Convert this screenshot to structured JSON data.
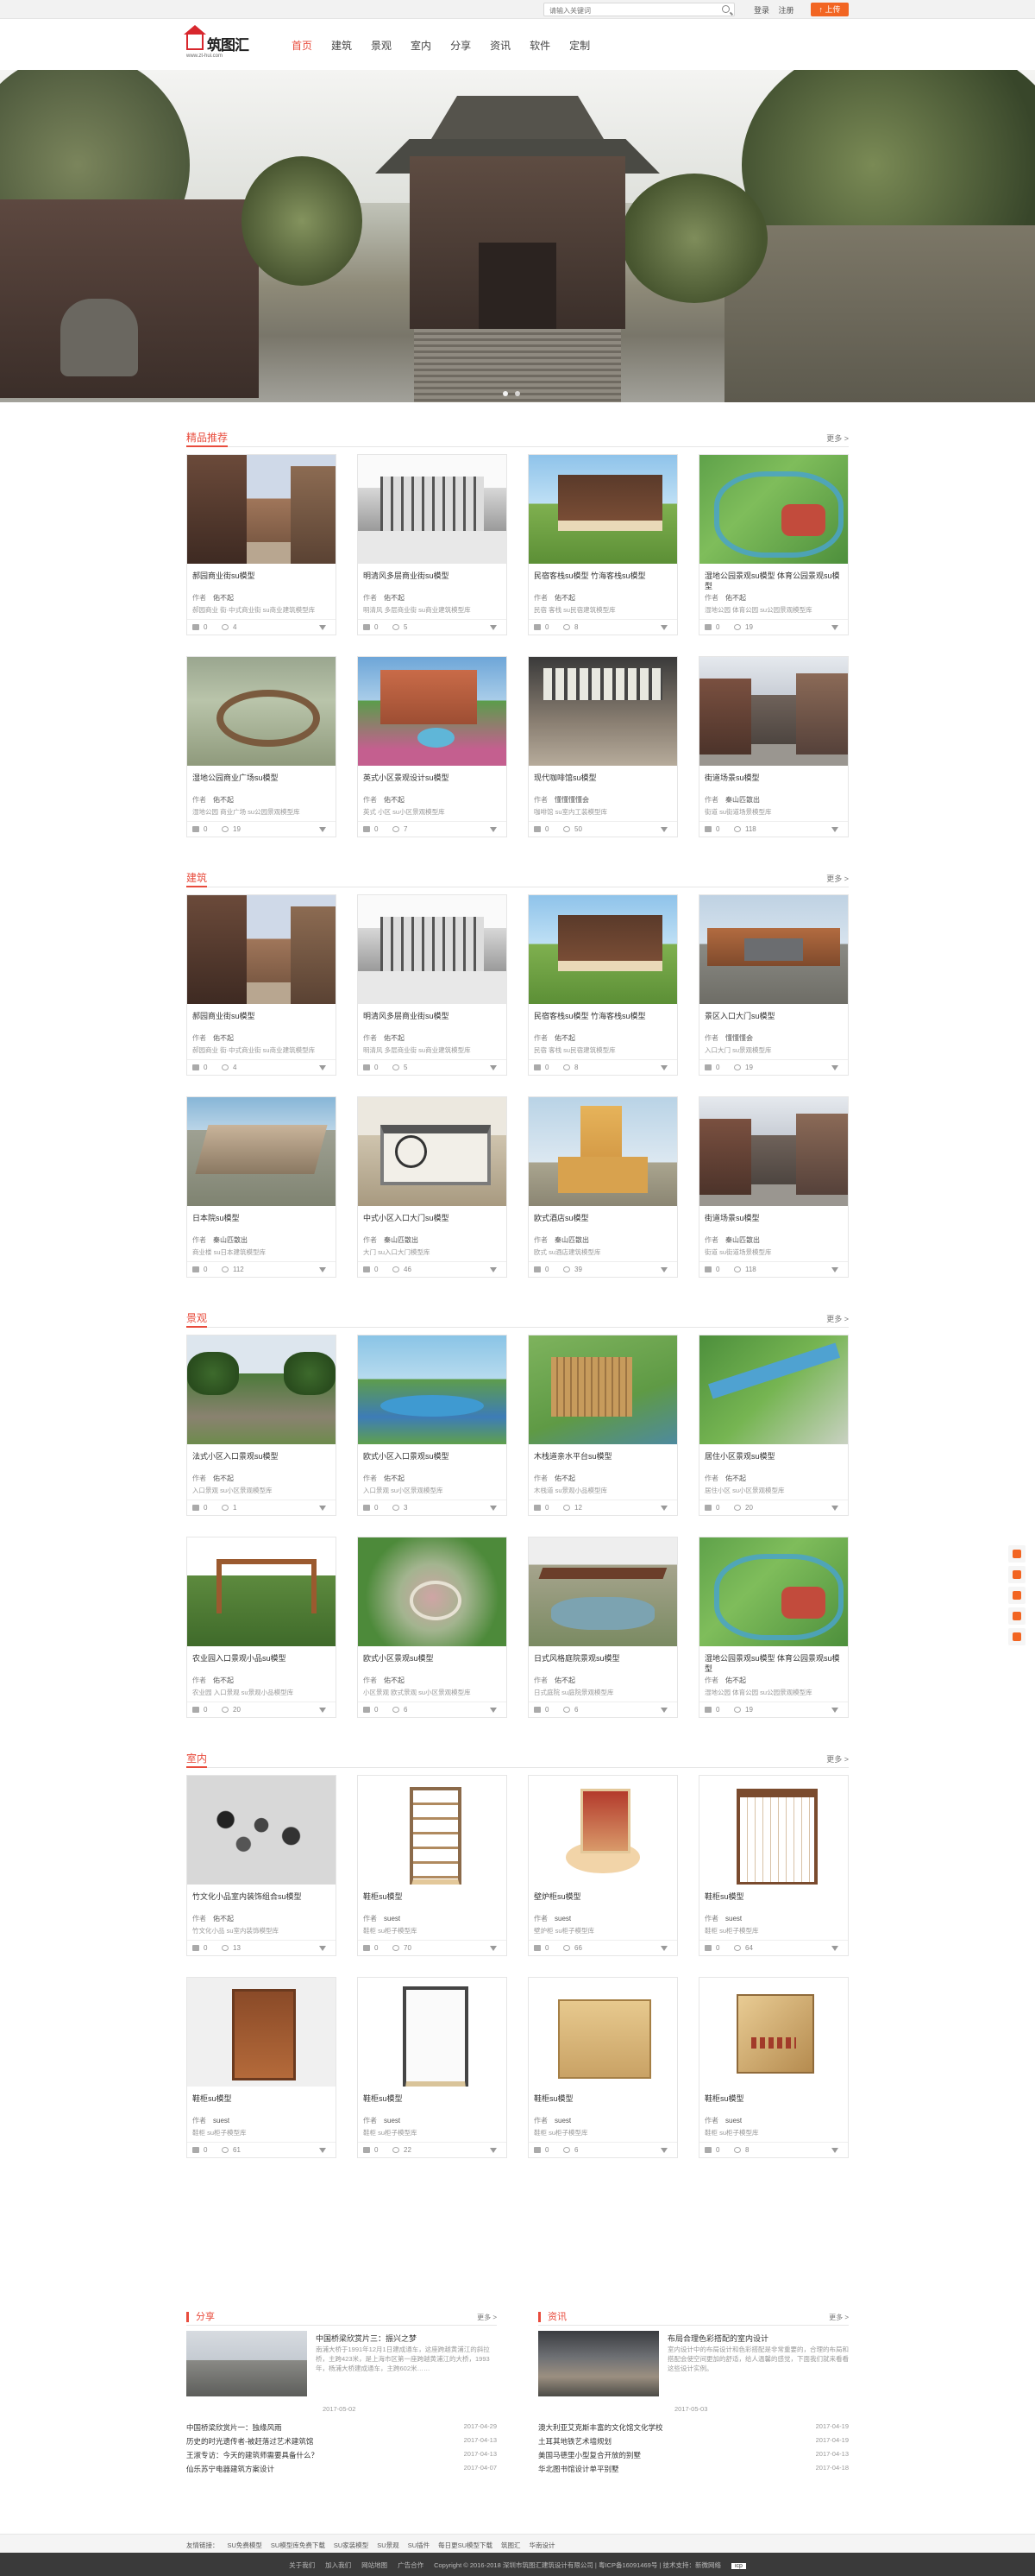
{
  "topbar": {
    "search_placeholder": "请输入关键词",
    "login": "登录",
    "register": "注册",
    "upload": "上传"
  },
  "logo": {
    "name": "筑图汇",
    "url": "www.zt-hui.com"
  },
  "nav": [
    "首页",
    "建筑",
    "景观",
    "室内",
    "分享",
    "资讯",
    "软件",
    "定制"
  ],
  "sections": [
    {
      "title": "精品推荐",
      "more": "更多 >",
      "cards": [
        {
          "title": "郝园商业街su模型",
          "author": "作者",
          "author_name": "佑不起",
          "tags": "郝园商业 街·中式商业街 su商业建筑模型库",
          "likes": "0",
          "views": "4",
          "scene": "s-street"
        },
        {
          "title": "明清风多层商业街su模型",
          "author": "作者",
          "author_name": "佑不起",
          "tags": "明清风 多层商业街 su商业建筑模型库",
          "likes": "0",
          "views": "5",
          "scene": "s-sketch"
        },
        {
          "title": "民宿客栈su模型 竹海客栈su模型",
          "author": "作者",
          "author_name": "佑不起",
          "tags": "民宿 客栈 su民宿建筑模型库",
          "likes": "0",
          "views": "8",
          "scene": "s-house"
        },
        {
          "title": "湿地公园景观su模型 体育公园景观su模型",
          "author": "作者",
          "author_name": "佑不起",
          "tags": "湿地公园 体育公园 su公园景观模型库",
          "likes": "0",
          "views": "19",
          "scene": "s-park"
        },
        {
          "title": "湿地公园商业广场su模型",
          "author": "作者",
          "author_name": "佑不起",
          "tags": "湿地公园 商业广场 su公园景观模型库",
          "likes": "0",
          "views": "19",
          "scene": "s-square"
        },
        {
          "title": "英式小区景观设计su模型",
          "author": "作者",
          "author_name": "佑不起",
          "tags": "英式 小区 su小区景观模型库",
          "likes": "0",
          "views": "7",
          "scene": "s-villa"
        },
        {
          "title": "现代咖啡馆su模型",
          "author": "作者",
          "author_name": "懂懂懂懂会",
          "tags": "咖啡馆 su室内工装模型库",
          "likes": "0",
          "views": "50",
          "scene": "s-cafe"
        },
        {
          "title": "街道场景su模型",
          "author": "作者",
          "author_name": "秦山匹散出",
          "tags": "街道 su街道场景模型库",
          "likes": "0",
          "views": "118",
          "scene": "s-road"
        }
      ]
    },
    {
      "title": "建筑",
      "more": "更多 >",
      "cards": [
        {
          "title": "郝园商业街su模型",
          "author": "作者",
          "author_name": "佑不起",
          "tags": "郝园商业 街·中式商业街 su商业建筑模型库",
          "likes": "0",
          "views": "4",
          "scene": "s-street"
        },
        {
          "title": "明清风多层商业街su模型",
          "author": "作者",
          "author_name": "佑不起",
          "tags": "明清风 多层商业街 su商业建筑模型库",
          "likes": "0",
          "views": "5",
          "scene": "s-sketch"
        },
        {
          "title": "民宿客栈su模型 竹海客栈su模型",
          "author": "作者",
          "author_name": "佑不起",
          "tags": "民宿 客栈 su民宿建筑模型库",
          "likes": "0",
          "views": "8",
          "scene": "s-house"
        },
        {
          "title": "景区入口大门su模型",
          "author": "作者",
          "author_name": "懂懂懂会",
          "tags": "入口大门 su景观模型库",
          "likes": "0",
          "views": "19",
          "scene": "s-gate"
        },
        {
          "title": "日本院su模型",
          "author": "作者",
          "author_name": "秦山匹散出",
          "tags": "商业楼 su日本建筑模型库",
          "likes": "0",
          "views": "112",
          "scene": "s-plaza"
        },
        {
          "title": "中式小区入口大门su模型",
          "author": "作者",
          "author_name": "秦山匹散出",
          "tags": "大门 su入口大门模型库",
          "likes": "0",
          "views": "46",
          "scene": "s-entry"
        },
        {
          "title": "欧式酒店su模型",
          "author": "作者",
          "author_name": "秦山匹散出",
          "tags": "欧式 su酒店建筑模型库",
          "likes": "0",
          "views": "39",
          "scene": "s-tower"
        },
        {
          "title": "街道场景su模型",
          "author": "作者",
          "author_name": "秦山匹散出",
          "tags": "街道 su街道场景模型库",
          "likes": "0",
          "views": "118",
          "scene": "s-road"
        }
      ]
    },
    {
      "title": "景观",
      "more": "更多 >",
      "cards": [
        {
          "title": "法式小区入口景观su模型",
          "author": "作者",
          "author_name": "佑不起",
          "tags": "入口景观 su小区景观模型库",
          "likes": "0",
          "views": "1",
          "scene": "s-avenue"
        },
        {
          "title": "欧式小区入口景观su模型",
          "author": "作者",
          "author_name": "佑不起",
          "tags": "入口景观 su小区景观模型库",
          "likes": "0",
          "views": "3",
          "scene": "s-pond"
        },
        {
          "title": "木栈道亲水平台su模型",
          "author": "作者",
          "author_name": "佑不起",
          "tags": "木栈道 su景观小品模型库",
          "likes": "0",
          "views": "12",
          "scene": "s-deck"
        },
        {
          "title": "居住小区景观su模型",
          "author": "作者",
          "author_name": "佑不起",
          "tags": "居住小区 su小区景观模型库",
          "likes": "0",
          "views": "20",
          "scene": "s-green"
        },
        {
          "title": "农业园入口景观小品su模型",
          "author": "作者",
          "author_name": "佑不起",
          "tags": "农业园 入口景观 su景观小品模型库",
          "likes": "0",
          "views": "20",
          "scene": "s-arch"
        },
        {
          "title": "欧式小区景观su模型",
          "author": "作者",
          "author_name": "佑不起",
          "tags": "小区景观 欧式景观 su小区景观模型库",
          "likes": "0",
          "views": "6",
          "scene": "s-garden"
        },
        {
          "title": "日式风格庭院景观su模型",
          "author": "作者",
          "author_name": "佑不起",
          "tags": "日式庭院 su庭院景观模型库",
          "likes": "0",
          "views": "6",
          "scene": "s-pavilion"
        },
        {
          "title": "湿地公园景观su模型 体育公园景观su模型",
          "author": "作者",
          "author_name": "佑不起",
          "tags": "湿地公园 体育公园 su公园景观模型库",
          "likes": "0",
          "views": "19",
          "scene": "s-park"
        }
      ]
    },
    {
      "title": "室内",
      "more": "更多 >",
      "cards": [
        {
          "title": "竹文化小品室内装饰组合su模型",
          "author": "作者",
          "author_name": "佑不起",
          "tags": "竹文化小品 su室内装饰模型库",
          "likes": "0",
          "views": "13",
          "scene": "s-parts"
        },
        {
          "title": "鞋柜su模型",
          "author": "作者",
          "author_name": "suest",
          "tags": "鞋柜 su柜子模型库",
          "likes": "0",
          "views": "70",
          "scene": "s-shelf"
        },
        {
          "title": "壁炉柜su模型",
          "author": "作者",
          "author_name": "suest",
          "tags": "壁炉柜 su柜子模型库",
          "likes": "0",
          "views": "66",
          "scene": "s-fire"
        },
        {
          "title": "鞋柜su模型",
          "author": "作者",
          "author_name": "suest",
          "tags": "鞋柜 su柜子模型库",
          "likes": "0",
          "views": "64",
          "scene": "s-rack"
        },
        {
          "title": "鞋柜su模型",
          "author": "作者",
          "author_name": "suest",
          "tags": "鞋柜 su柜子模型库",
          "likes": "0",
          "views": "61",
          "scene": "s-shoe1"
        },
        {
          "title": "鞋柜su模型",
          "author": "作者",
          "author_name": "suest",
          "tags": "鞋柜 su柜子模型库",
          "likes": "0",
          "views": "22",
          "scene": "s-shoe2"
        },
        {
          "title": "鞋柜su模型",
          "author": "作者",
          "author_name": "suest",
          "tags": "鞋柜 su柜子模型库",
          "likes": "0",
          "views": "6",
          "scene": "s-shoe3"
        },
        {
          "title": "鞋柜su模型",
          "author": "作者",
          "author_name": "suest",
          "tags": "鞋柜 su柜子模型库",
          "likes": "0",
          "views": "8",
          "scene": "s-shoe4"
        }
      ]
    }
  ],
  "share": {
    "title": "分享",
    "more": "更多 >",
    "feat_title": "中国桥梁欣赏片三：振兴之梦",
    "feat_desc": "南浦大桥于1991年12月1日建成通车，这座跨越黄浦江的斜拉桥，主跨423米，是上海市区第一座跨越黄浦江的大桥，1993年，杨浦大桥建成通车，主跨602米……",
    "feat_date": "2017-05-02",
    "items": [
      {
        "t": "中国桥梁欣赏片一：独缘风雨",
        "d": "2017-04-29"
      },
      {
        "t": "历史的时光遗传者-被赶落过艺术建筑馆",
        "d": "2017-04-13"
      },
      {
        "t": "王淑专访：今天的建筑师需要具备什么？",
        "d": "2017-04-13"
      },
      {
        "t": "仙乐苏宁电器建筑方案设计",
        "d": "2017-04-07"
      }
    ]
  },
  "news": {
    "title": "资讯",
    "more": "更多 >",
    "feat_title": "布局合理色彩搭配的室内设计",
    "feat_desc": "室内设计中的布局设计和色彩搭配是非常重要的，合理的布局和搭配会使空间更加的舒适，给人温馨的感觉，下面我们就来看看这些设计实例。",
    "feat_date": "2017-05-03",
    "items": [
      {
        "t": "澳大利亚艾克斯丰富的文化馆文化学校",
        "d": "2017-04-19"
      },
      {
        "t": "土耳其地铁艺术墙规划",
        "d": "2017-04-19"
      },
      {
        "t": "美国马德里小型复合开放的别墅",
        "d": "2017-04-13"
      },
      {
        "t": "华北图书馆设计单平别墅",
        "d": "2017-04-18"
      }
    ]
  },
  "footer": {
    "links": [
      "友情链接：",
      "SU免费模型",
      "SU模型库免费下载",
      "SU家装模型",
      "SU景观",
      "SU插件",
      "每日更SU模型下载",
      "筑图汇",
      "华南设计"
    ],
    "bar": [
      "关于我们",
      "加入我们",
      "网站地图",
      "广告合作",
      "Copyright © 2016-2018 深圳市筑图汇建筑设计有限公司 | 粤ICP备16091469号 | 技术支持：新微网络"
    ],
    "icp": "icp"
  },
  "colors": {
    "accent": "#e84c3d",
    "upload": "#f26522"
  }
}
